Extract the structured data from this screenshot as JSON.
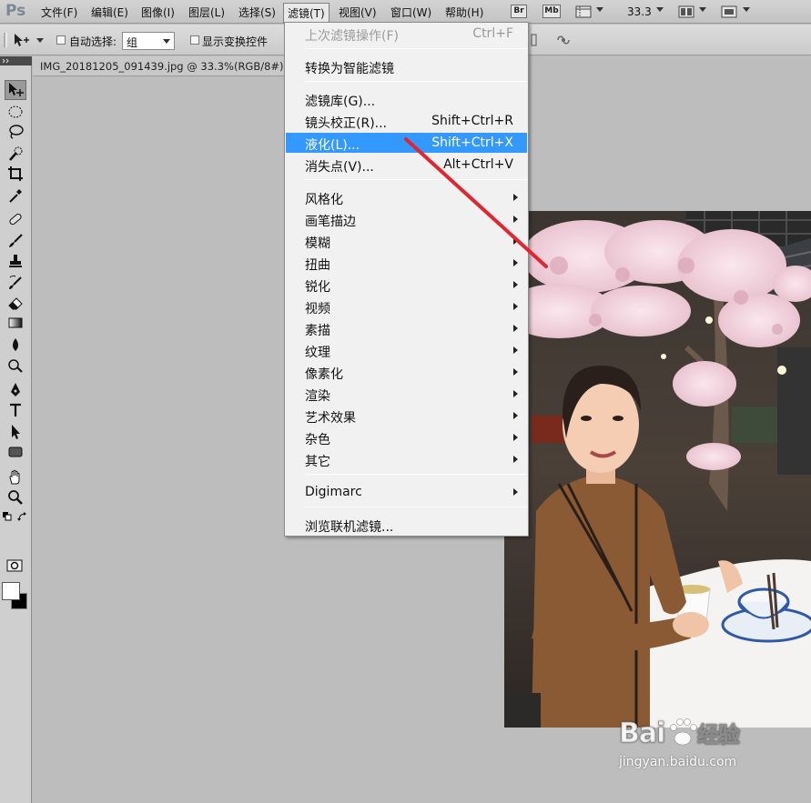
{
  "app": {
    "logo": "Ps"
  },
  "menubar": {
    "items": [
      "文件(F)",
      "编辑(E)",
      "图像(I)",
      "图层(L)",
      "选择(S)",
      "滤镜(T)",
      "视图(V)",
      "窗口(W)",
      "帮助(H)"
    ],
    "active_item": "滤镜(T)",
    "bridge_button": "Br",
    "minibridge_button": "Mb",
    "zoom_level": "33.3"
  },
  "options_bar": {
    "auto_select_label": "自动选择:",
    "auto_select_checked": false,
    "group_value": "组",
    "show_transform_label": "显示变换控件",
    "show_transform_checked": false
  },
  "document": {
    "tab_title": "IMG_20181205_091439.jpg @ 33.3%(RGB/8#) *"
  },
  "filter_menu": {
    "last_filter": {
      "label": "上次滤镜操作(F)",
      "shortcut": "Ctrl+F",
      "disabled": true
    },
    "convert_smart": {
      "label": "转换为智能滤镜"
    },
    "filter_gallery": {
      "label": "滤镜库(G)..."
    },
    "lens_correction": {
      "label": "镜头校正(R)...",
      "shortcut": "Shift+Ctrl+R"
    },
    "liquify": {
      "label": "液化(L)...",
      "shortcut": "Shift+Ctrl+X",
      "highlighted": true
    },
    "vanishing_point": {
      "label": "消失点(V)...",
      "shortcut": "Alt+Ctrl+V"
    },
    "submenus": [
      "风格化",
      "画笔描边",
      "模糊",
      "扭曲",
      "锐化",
      "视频",
      "素描",
      "纹理",
      "像素化",
      "渲染",
      "艺术效果",
      "杂色",
      "其它"
    ],
    "digimarc": {
      "label": "Digimarc"
    },
    "browse_online": {
      "label": "浏览联机滤镜..."
    }
  },
  "colors": {
    "highlight": "#3399ff",
    "annotation_arrow": "#e0262f",
    "foreground": "#ffffff",
    "background": "#000000"
  },
  "watermark": {
    "logo": "Bai du 经验",
    "url": "jingyan.baidu.com"
  }
}
